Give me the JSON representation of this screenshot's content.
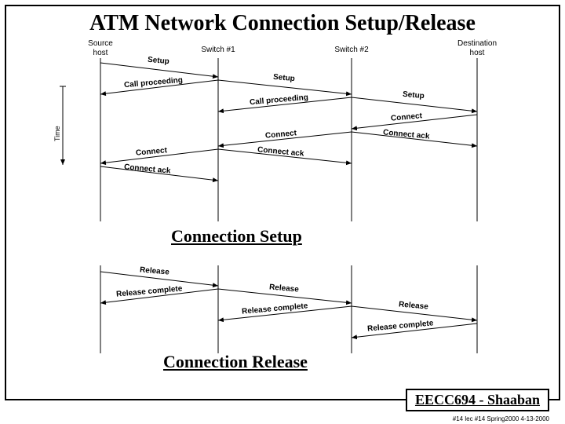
{
  "title": "ATM Network Connection Setup/Release",
  "nodes": {
    "source_top": "Source",
    "source_bottom": "host",
    "sw1": "Switch #1",
    "sw2": "Switch #2",
    "dest_top": "Destination",
    "dest_bottom": "host"
  },
  "time_axis": "Time",
  "sections": {
    "setup": "Connection Setup",
    "release": "Connection Release"
  },
  "messages": {
    "setup": "Setup",
    "callproc": "Call proceeding",
    "connect": "Connect",
    "connack": "Connect ack",
    "release": "Release",
    "relcomp": "Release complete"
  },
  "footer": "EECC694 - Shaaban",
  "smallfoot": "#14 lec #14 Spring2000 4-13-2000"
}
